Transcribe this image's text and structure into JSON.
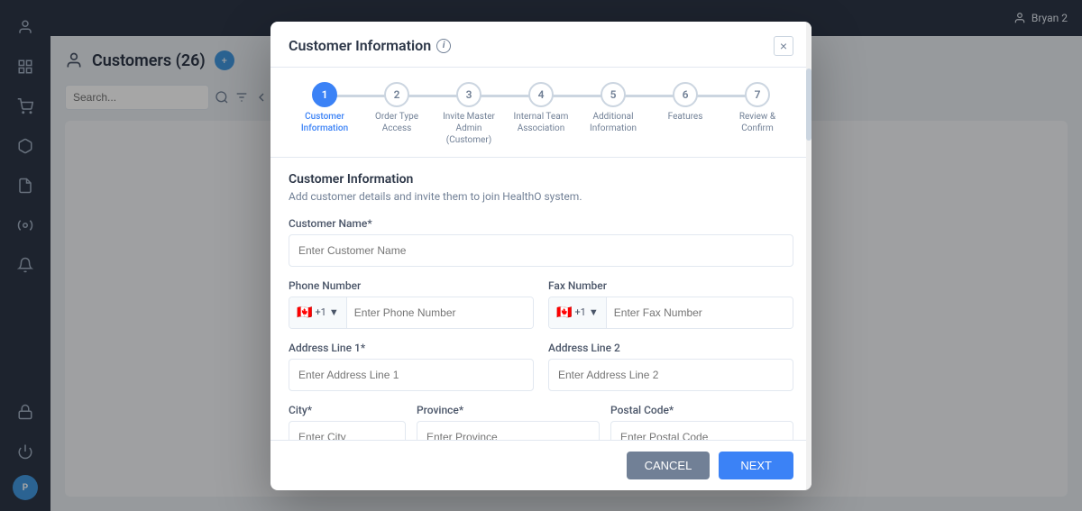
{
  "app": {
    "title": "Customers (26)",
    "badge": "26",
    "user": "Bryan 2"
  },
  "sidebar": {
    "icons": [
      "👤",
      "🛒",
      "📦",
      "📄",
      "⚙️",
      "🔔",
      "🔒",
      "⏻"
    ],
    "avatar_label": "P"
  },
  "modal": {
    "title": "Customer Information",
    "close_label": "×",
    "steps": [
      {
        "number": "1",
        "label": "Customer\nInformation",
        "active": true
      },
      {
        "number": "2",
        "label": "Order Type Access",
        "active": false
      },
      {
        "number": "3",
        "label": "Invite Master Admin (Customer)",
        "active": false
      },
      {
        "number": "4",
        "label": "Internal Team Association",
        "active": false
      },
      {
        "number": "5",
        "label": "Additional Information",
        "active": false
      },
      {
        "number": "6",
        "label": "Features",
        "active": false
      },
      {
        "number": "7",
        "label": "Review & Confirm",
        "active": false
      }
    ],
    "section_title": "Customer Information",
    "section_desc": "Add customer details and invite them to join HealthO system.",
    "fields": {
      "customer_name_label": "Customer Name*",
      "customer_name_placeholder": "Enter Customer Name",
      "phone_number_label": "Phone Number",
      "phone_number_placeholder": "Enter Phone Number",
      "phone_country_code": "+1",
      "fax_number_label": "Fax Number",
      "fax_number_placeholder": "Enter Fax Number",
      "fax_country_code": "+1",
      "address_line1_label": "Address Line 1*",
      "address_line1_placeholder": "Enter Address Line 1",
      "address_line2_label": "Address Line 2",
      "address_line2_placeholder": "Enter Address Line 2",
      "city_label": "City*",
      "city_placeholder": "Enter City",
      "province_label": "Province*",
      "province_placeholder": "Enter Province",
      "postal_code_label": "Postal Code*",
      "postal_code_placeholder": "Enter Postal Code"
    },
    "buttons": {
      "cancel": "CANCEL",
      "next": "NEXT"
    }
  }
}
